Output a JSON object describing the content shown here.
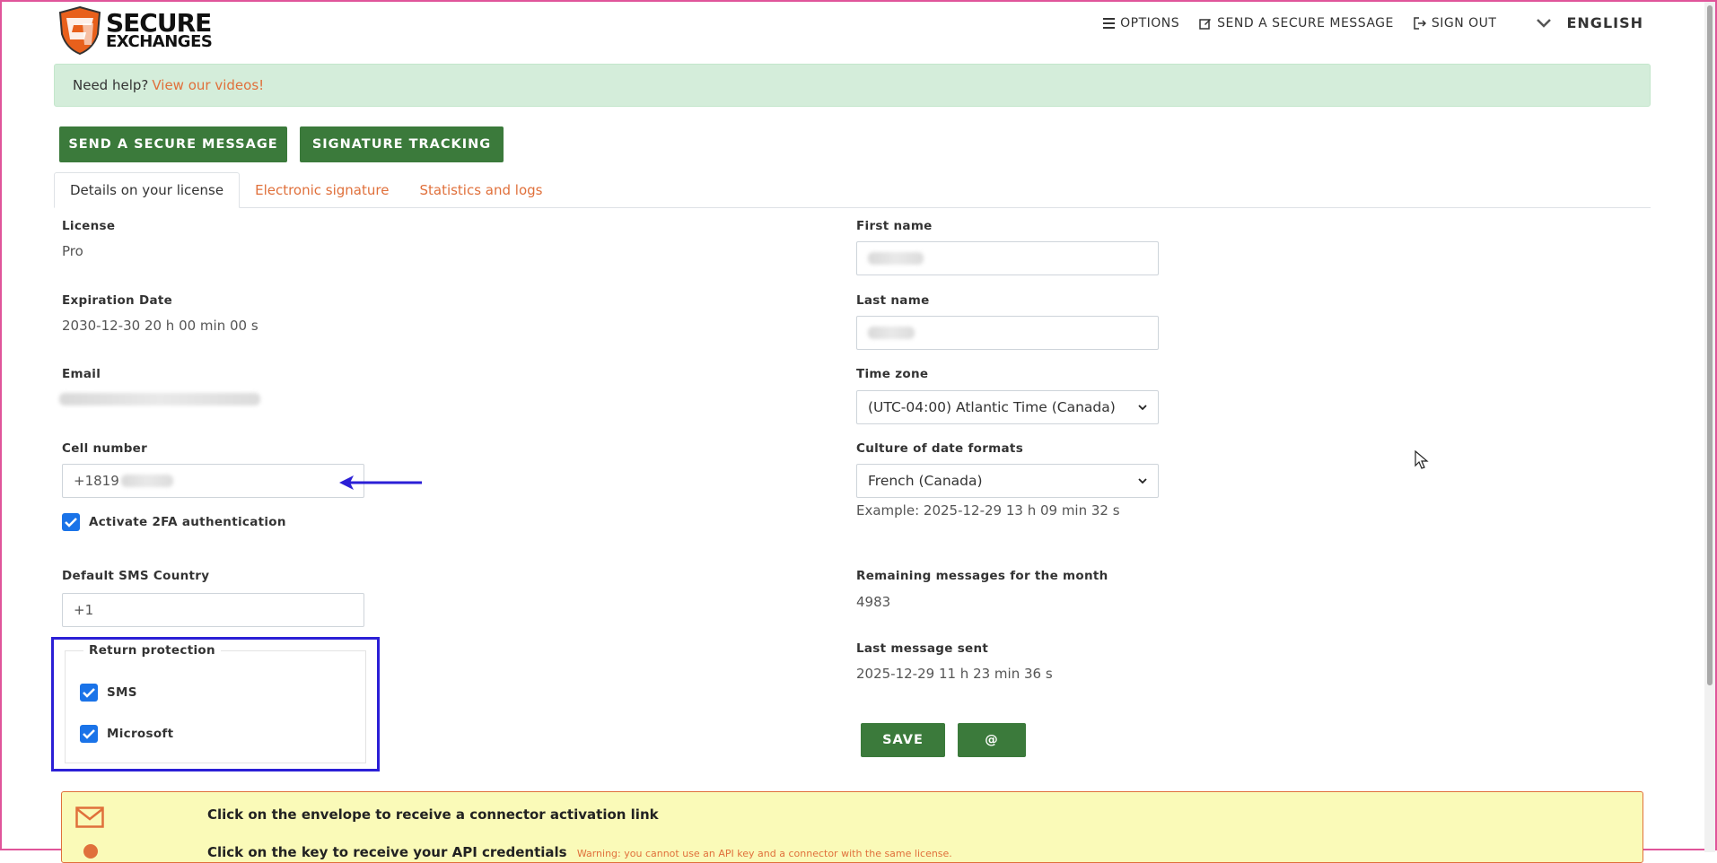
{
  "brand": {
    "line1": "SECURE",
    "line2": "EXCHANGES"
  },
  "nav": {
    "options": "OPTIONS",
    "send_message": "SEND A SECURE MESSAGE",
    "sign_out": "SIGN OUT",
    "language": "ENGLISH"
  },
  "help": {
    "text": "Need help?",
    "link": "View our videos!"
  },
  "actions": {
    "send_message": "SEND A SECURE MESSAGE",
    "signature_tracking": "SIGNATURE TRACKING"
  },
  "tabs": [
    {
      "label": "Details on your license",
      "active": true
    },
    {
      "label": "Electronic signature",
      "active": false
    },
    {
      "label": "Statistics and logs",
      "active": false
    }
  ],
  "left": {
    "license_label": "License",
    "license_value": "Pro",
    "expiration_label": "Expiration Date",
    "expiration_value": "2030-12-30 20 h 00 min 00 s",
    "email_label": "Email",
    "cell_label": "Cell number",
    "cell_value": "+1819",
    "twofa_label": "Activate 2FA authentication",
    "sms_country_label": "Default SMS Country",
    "sms_country_value": "+1",
    "return_protection_label": "Return protection",
    "return_sms": "SMS",
    "return_microsoft": "Microsoft"
  },
  "right": {
    "first_name_label": "First name",
    "last_name_label": "Last name",
    "timezone_label": "Time zone",
    "timezone_value": "(UTC-04:00) Atlantic Time (Canada)",
    "culture_label": "Culture of date formats",
    "culture_value": "French (Canada)",
    "culture_example": "Example: 2025-12-29 13 h 09 min 32 s",
    "remaining_label": "Remaining messages for the month",
    "remaining_value": "4983",
    "last_sent_label": "Last message sent",
    "last_sent_value": "2025-12-29 11 h 23 min 36 s",
    "save": "SAVE",
    "at": "@"
  },
  "connector": {
    "envelope_text": "Click on the envelope to receive a connector activation link",
    "key_text": "Click on the key to receive your API credentials",
    "key_warning": "Warning: you cannot use an API key and a connector with the same license."
  },
  "colors": {
    "accent_green": "#3b7a3b",
    "link_orange": "#e0703b",
    "highlight_blue": "#2b1fd6"
  }
}
